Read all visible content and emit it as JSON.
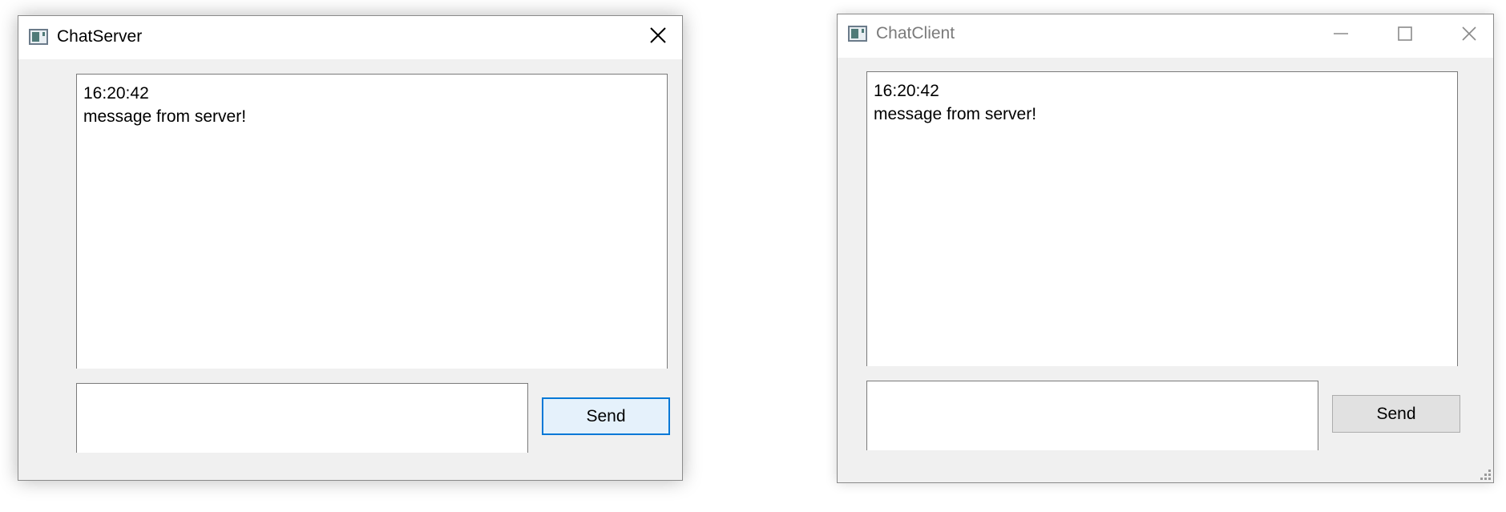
{
  "server_window": {
    "title": "ChatServer",
    "icon": "app-window-icon",
    "close_icon": "close-icon",
    "chat_log": {
      "lines": [
        "16:20:42",
        "message from server!"
      ]
    },
    "message_input": {
      "value": ""
    },
    "send_label": "Send"
  },
  "client_window": {
    "title": "ChatClient",
    "icon": "app-window-icon",
    "minimize_icon": "minimize-icon",
    "maximize_icon": "maximize-icon",
    "close_icon": "close-icon",
    "chat_log": {
      "lines": [
        "16:20:42",
        "message from server!"
      ]
    },
    "message_input": {
      "value": ""
    },
    "send_label": "Send",
    "resize_icon": "resize-grip-icon"
  }
}
